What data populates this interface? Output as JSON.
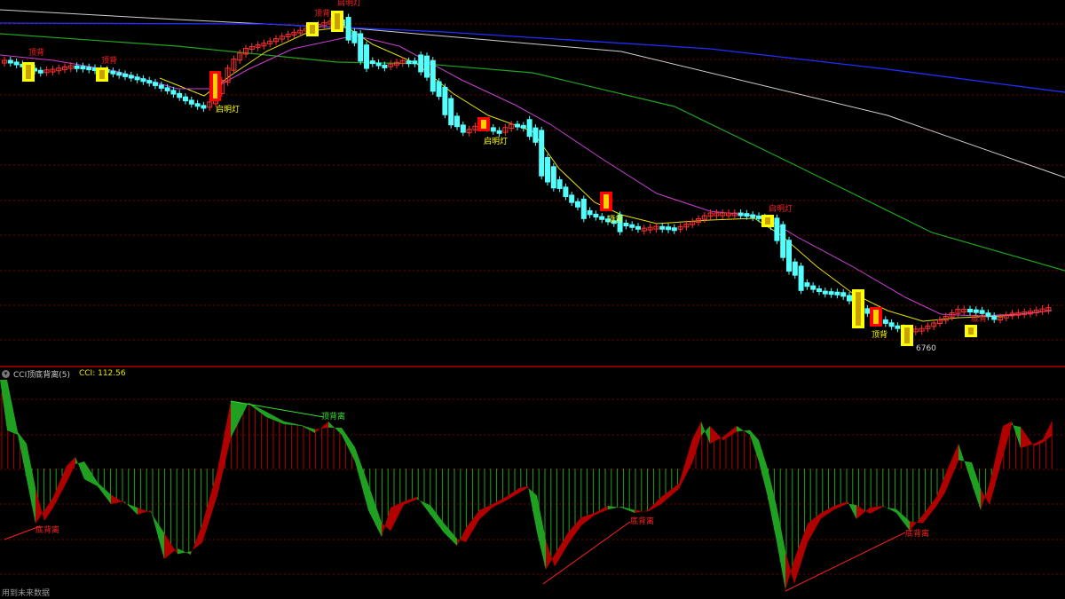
{
  "colors": {
    "background": "#000000",
    "grid": "#7a0000",
    "up_candle": "#ff3030",
    "down_candle": "#54ffff",
    "ma_white": "#d0d0d0",
    "ma_blue": "#1f2fff",
    "ma_green": "#1fa51f",
    "ma_magenta": "#c93fd1",
    "ma_yellow": "#e8e000",
    "signal_yellow": "#ffff00",
    "signal_red": "#ff0000",
    "cci_green": "#20a020",
    "cci_red": "#b00000",
    "label_red": "#ff2020",
    "label_yellow": "#ffff00",
    "label_green": "#34e034",
    "divider": "#b00000"
  },
  "indicator": {
    "icon": "chevron-down-icon",
    "name": "CCI顶底背离(5)",
    "value_text": "CCI: 112.56"
  },
  "footer_text": "用到未来数据",
  "chart_data": [
    {
      "type": "candlestick",
      "panel": "price",
      "price_labels": [
        "6760"
      ],
      "signal_labels": [
        "顶背",
        "顶背",
        "启明灯",
        "顶背",
        "启明灯",
        "启明灯",
        "顶背",
        "顶背",
        "启明灯",
        "顶背",
        "启明灯",
        "底背"
      ],
      "markers": [
        {
          "label": "顶背",
          "color": "red"
        },
        {
          "label": "顶背",
          "color": "red"
        },
        {
          "label": "启明灯",
          "color": "yellow"
        },
        {
          "label": "顶背",
          "color": "red"
        },
        {
          "label": "启明灯",
          "color": "yellow"
        },
        {
          "label": "启明灯",
          "color": "yellow"
        },
        {
          "label": "顶背",
          "color": "red"
        },
        {
          "label": "顶背",
          "color": "red"
        },
        {
          "label": "启明灯",
          "color": "yellow"
        },
        {
          "label": "6760",
          "color": "white"
        },
        {
          "label": "底背",
          "color": "red"
        }
      ]
    },
    {
      "type": "area",
      "panel": "indicator",
      "name": "CCI",
      "last_value": 112.56,
      "divergence_labels": [
        "顶背离",
        "底背离",
        "底背离",
        "底背离",
        "顶背离"
      ]
    }
  ]
}
